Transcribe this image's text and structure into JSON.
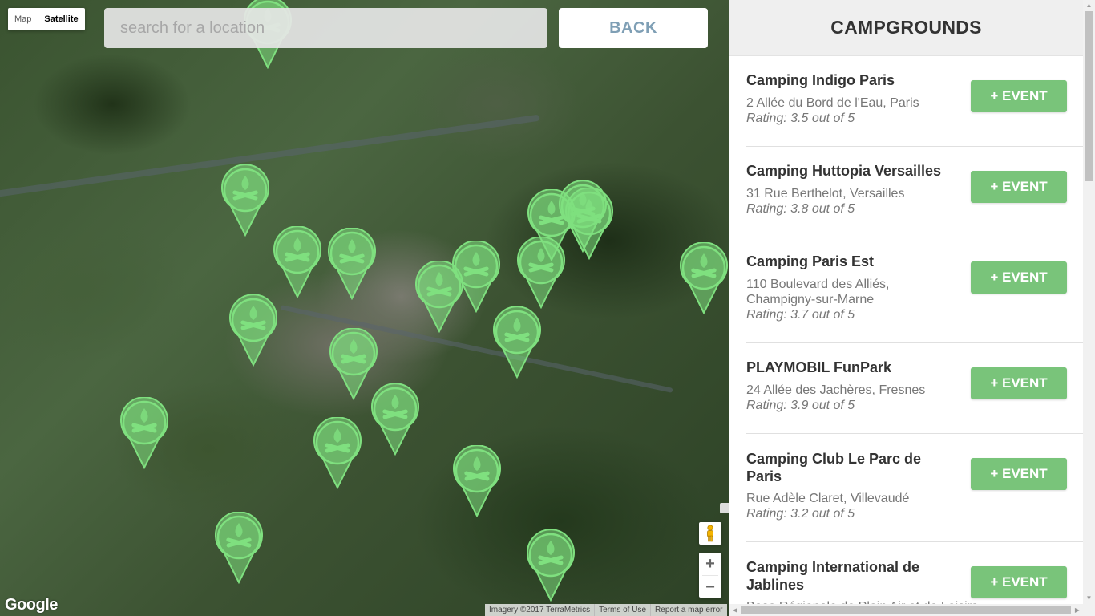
{
  "map": {
    "type_control": {
      "map_label": "Map",
      "satellite_label": "Satellite"
    },
    "search": {
      "placeholder": "search for a location",
      "value": ""
    },
    "back_label": "BACK",
    "zoom_in_label": "+",
    "zoom_out_label": "−",
    "logo_text": "Google",
    "attribution": [
      "Imagery ©2017 TerraMetrics",
      "Terms of Use",
      "Report a map error"
    ],
    "marker_icon": "campfire-marker-icon",
    "marker_color": "#7fe07f"
  },
  "sidebar": {
    "title": "CAMPGROUNDS",
    "event_label": "+ EVENT",
    "items": [
      {
        "name": "Camping Indigo Paris",
        "address": "2 Allée du Bord de l'Eau, Paris",
        "rating": "Rating: 3.5 out of 5"
      },
      {
        "name": "Camping Huttopia Versailles",
        "address": "31 Rue Berthelot, Versailles",
        "rating": "Rating: 3.8 out of 5"
      },
      {
        "name": "Camping Paris Est",
        "address": "110 Boulevard des Alliés, Champigny-sur-Marne",
        "rating": "Rating: 3.7 out of 5"
      },
      {
        "name": "PLAYMOBIL FunPark",
        "address": "24 Allée des Jachères, Fresnes",
        "rating": "Rating: 3.9 out of 5"
      },
      {
        "name": "Camping Club Le Parc de Paris",
        "address": "Rue Adèle Claret, Villevaudé",
        "rating": "Rating: 3.2 out of 5"
      },
      {
        "name": "Camping International de Jablines",
        "address": "Base Régionale de Plein Air et de Loisirs",
        "rating": ""
      }
    ]
  },
  "colors": {
    "accent": "#79c47a",
    "back_text": "#7f9fb5"
  }
}
